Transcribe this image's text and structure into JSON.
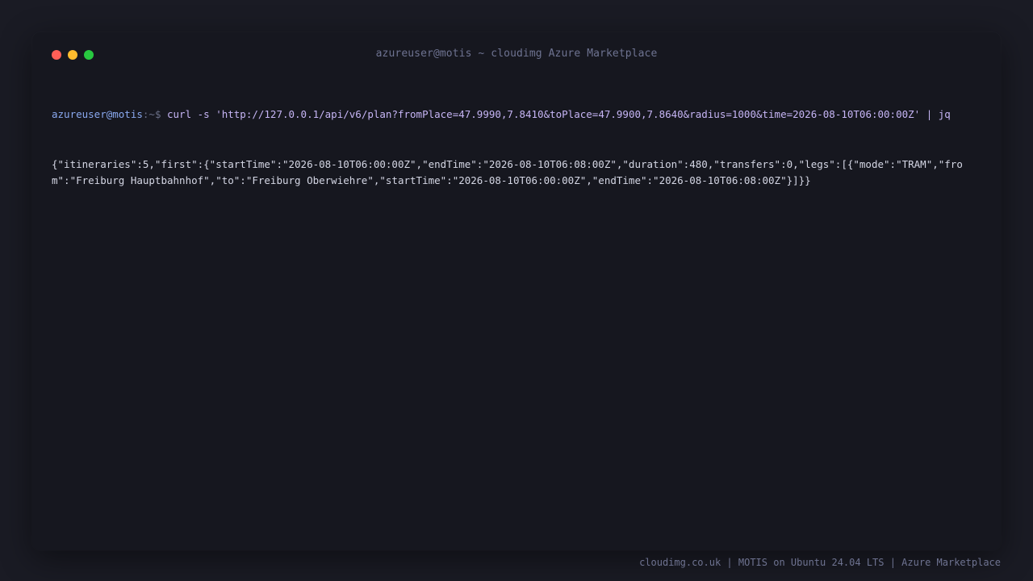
{
  "window": {
    "title": "azureuser@motis ~ cloudimg Azure Marketplace"
  },
  "terminal": {
    "prompt_user": "azureuser@motis",
    "prompt_path": ":~$",
    "command": " curl -s 'http://127.0.0.1/api/v6/plan?fromPlace=47.9990,7.8410&toPlace=47.9900,7.8640&radius=1000&time=2026-08-10T06:00:00Z' | jq",
    "output": "{\"itineraries\":5,\"first\":{\"startTime\":\"2026-08-10T06:00:00Z\",\"endTime\":\"2026-08-10T06:08:00Z\",\"duration\":480,\"transfers\":0,\"legs\":[{\"mode\":\"TRAM\",\"from\":\"Freiburg Hauptbahnhof\",\"to\":\"Freiburg Oberwiehre\",\"startTime\":\"2026-08-10T06:00:00Z\",\"endTime\":\"2026-08-10T06:08:00Z\"}]}}"
  },
  "footer": {
    "text": "cloudimg.co.uk | MOTIS on Ubuntu 24.04 LTS | Azure Marketplace"
  },
  "colors": {
    "close": "#ff5f57",
    "minimize": "#febc2e",
    "maximize": "#28c840"
  }
}
